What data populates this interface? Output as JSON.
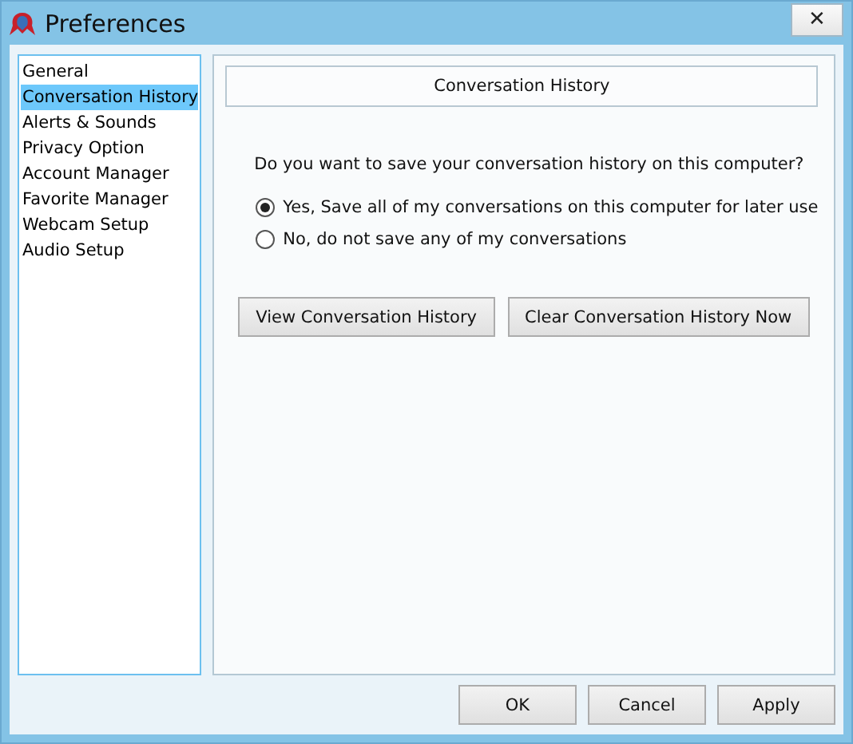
{
  "window": {
    "title": "Preferences",
    "close": "✕"
  },
  "sidebar": {
    "items": [
      {
        "label": "General",
        "selected": false
      },
      {
        "label": "Conversation History",
        "selected": true
      },
      {
        "label": "Alerts & Sounds",
        "selected": false
      },
      {
        "label": "Privacy Option",
        "selected": false
      },
      {
        "label": "Account Manager",
        "selected": false
      },
      {
        "label": "Favorite Manager",
        "selected": false
      },
      {
        "label": "Webcam Setup",
        "selected": false
      },
      {
        "label": "Audio Setup",
        "selected": false
      }
    ]
  },
  "panel": {
    "heading": "Conversation History",
    "question": "Do you want to save your conversation history on this computer?",
    "options": [
      {
        "label": "Yes, Save all of my conversations on this computer for later use",
        "selected": true
      },
      {
        "label": "No, do not save any of my conversations",
        "selected": false
      }
    ],
    "actions": [
      "View Conversation History",
      "Clear Conversation History Now"
    ]
  },
  "buttons": [
    "OK",
    "Cancel",
    "Apply"
  ]
}
